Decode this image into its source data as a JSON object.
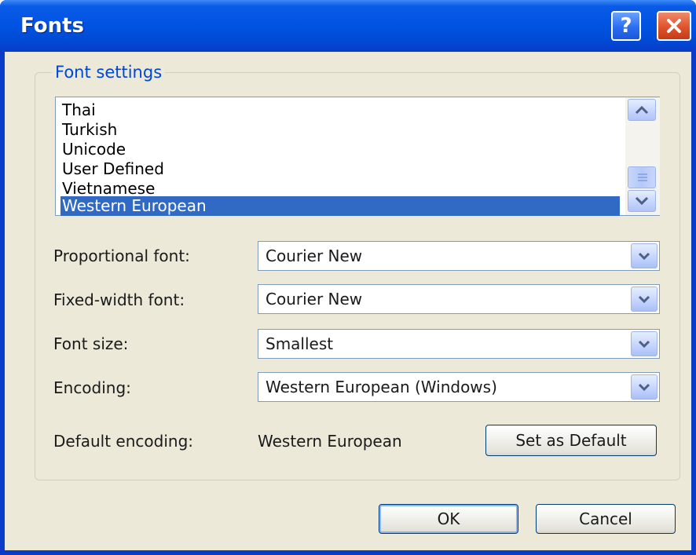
{
  "window": {
    "title": "Fonts",
    "help_label": "?"
  },
  "font_settings": {
    "legend": "Font settings",
    "languages": [
      "Thai",
      "Turkish",
      "Unicode",
      "User Defined",
      "Vietnamese",
      "Western European"
    ],
    "selected_language": "Western European"
  },
  "fields": {
    "proportional": {
      "label": "Proportional font:",
      "value": "Courier New"
    },
    "fixed_width": {
      "label": "Fixed-width font:",
      "value": "Courier New"
    },
    "font_size": {
      "label": "Font size:",
      "value": "Smallest"
    },
    "encoding": {
      "label": "Encoding:",
      "value": "Western European (Windows)"
    }
  },
  "default_encoding": {
    "label": "Default encoding:",
    "value": "Western European",
    "button_label": "Set as Default"
  },
  "buttons": {
    "ok_label": "OK",
    "cancel_label": "Cancel"
  },
  "colors": {
    "titlebar": "#0053e1",
    "selection": "#316ac5",
    "dialog_face": "#ece9d8",
    "legend_text": "#0046d5"
  }
}
